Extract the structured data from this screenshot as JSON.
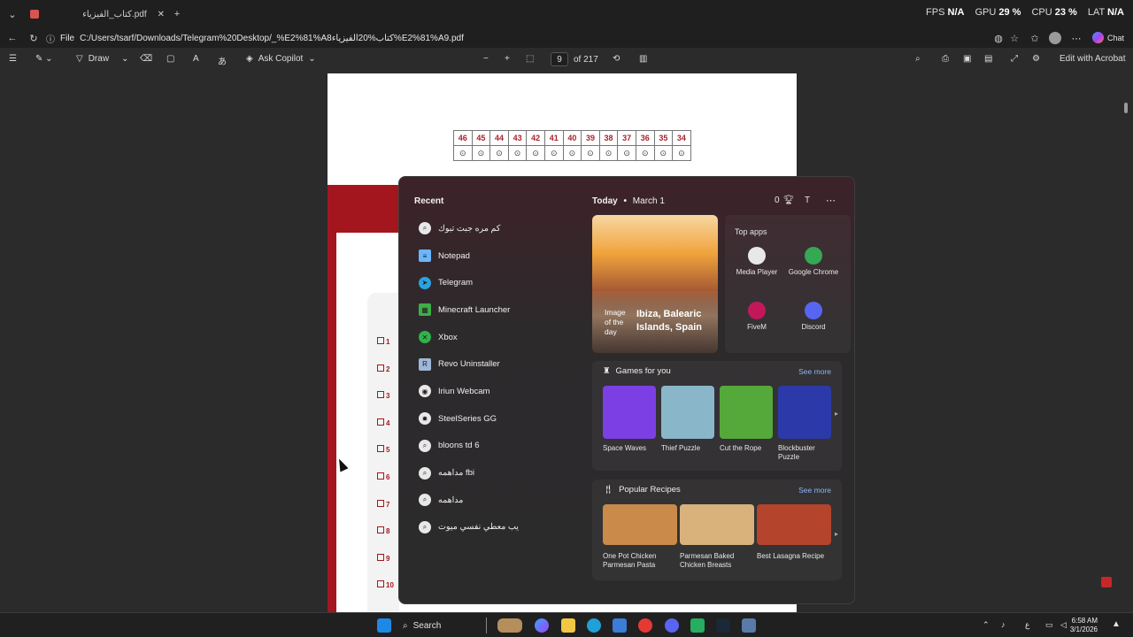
{
  "browser": {
    "tab_title": "كتاب_الفيزياء.pdf",
    "url_prefix": "File",
    "url": "C:/Users/tsarf/Downloads/Telegram%20Desktop/_%E2%81%A8كتاب%20الفيزياء%E2%81%A9.pdf",
    "chat_label": "Chat"
  },
  "perf_overlay": {
    "fps_label": "FPS",
    "fps_value": "N/A",
    "gpu_label": "GPU",
    "gpu_value": "29 %",
    "cpu_label": "CPU",
    "cpu_value": "23 %",
    "lat_label": "LAT",
    "lat_value": "N/A"
  },
  "pdf_toolbar": {
    "draw_label": "Draw",
    "copilot_label": "Ask Copilot",
    "page_current": "9",
    "page_total": "of 217",
    "acrobat_label": "Edit with Acrobat"
  },
  "document": {
    "numbers": [
      "46",
      "45",
      "44",
      "43",
      "42",
      "41",
      "40",
      "39",
      "38",
      "37",
      "36",
      "35",
      "34"
    ],
    "circle_glyph": "⊙",
    "qmarks": [
      "1",
      "2",
      "3",
      "4",
      "5",
      "6",
      "7",
      "8",
      "9",
      "10"
    ]
  },
  "start_menu": {
    "recent_heading": "Recent",
    "recent": [
      {
        "label": "كم مره جبت تبوك",
        "icon": "search-icon"
      },
      {
        "label": "Notepad",
        "icon": "notepad-icon"
      },
      {
        "label": "Telegram",
        "icon": "telegram-icon"
      },
      {
        "label": "Minecraft Launcher",
        "icon": "minecraft-icon"
      },
      {
        "label": "Xbox",
        "icon": "xbox-icon"
      },
      {
        "label": "Revo Uninstaller",
        "icon": "revo-icon"
      },
      {
        "label": "Iriun Webcam",
        "icon": "webcam-icon"
      },
      {
        "label": "SteelSeries GG",
        "icon": "steelseries-icon"
      },
      {
        "label": "bloons td 6",
        "icon": "search-icon"
      },
      {
        "label": "مداهمه fbi",
        "icon": "search-icon"
      },
      {
        "label": "مداهمه",
        "icon": "search-icon"
      },
      {
        "label": "يب معطي نفسي ميوت",
        "icon": "search-icon"
      }
    ],
    "today_label": "Today",
    "date_label": "March 1",
    "points": "0",
    "avatar_initial": "T",
    "image_of_day_label": "Image of the day",
    "image_of_day_place": "Ibiza, Balearic Islands, Spain",
    "top_apps_heading": "Top apps",
    "top_apps": [
      {
        "label": "Media Player",
        "color": "#e8e8e8"
      },
      {
        "label": "Google Chrome",
        "color": "#34a853"
      },
      {
        "label": "FiveM",
        "color": "#c2185b"
      },
      {
        "label": "Discord",
        "color": "#5865f2"
      }
    ],
    "games_heading": "Games for you",
    "games_see_more": "See more",
    "games": [
      {
        "label": "Space Waves",
        "color": "#7b3fe4"
      },
      {
        "label": "Thief Puzzle",
        "color": "#8ab6c9"
      },
      {
        "label": "Cut the Rope",
        "color": "#55a83a"
      },
      {
        "label": "Blockbuster Puzzle",
        "color": "#2b3aa8"
      }
    ],
    "recipes_heading": "Popular Recipes",
    "recipes_see_more": "See more",
    "recipes": [
      {
        "label": "One Pot Chicken Parmesan Pasta",
        "color": "#c98a4a"
      },
      {
        "label": "Parmesan Baked Chicken Breasts",
        "color": "#d8b27a"
      },
      {
        "label": "Best Lasagna Recipe",
        "color": "#b4442c"
      }
    ]
  },
  "taskbar": {
    "search_label": "Search",
    "time": "6:58 AM",
    "date": "3/1/2026",
    "lang": "ع"
  }
}
